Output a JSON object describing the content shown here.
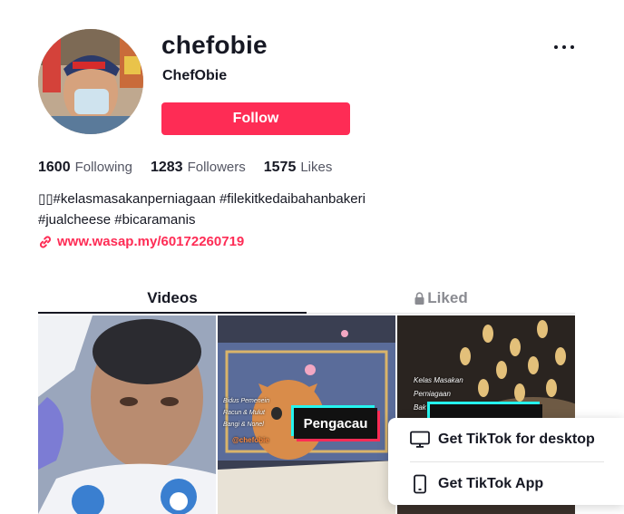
{
  "profile": {
    "username": "chefobie",
    "nickname": "ChefObie",
    "follow_label": "Follow",
    "stats": [
      {
        "value": "1600",
        "label": "Following"
      },
      {
        "value": "1283",
        "label": "Followers"
      },
      {
        "value": "1575",
        "label": "Likes"
      }
    ],
    "bio_line1": "▯▯#kelasmasakanperniagaan #filekitkedaibahanbakeri",
    "bio_line2": "#jualcheese #bicaramanis",
    "link": "www.wasap.my/60172260719"
  },
  "tabs": [
    {
      "label": "Videos",
      "active": true
    },
    {
      "label": "Liked",
      "locked": true
    }
  ],
  "videos": [
    {
      "caption": ""
    },
    {
      "caption_lines": [
        "Bidus Pemenein",
        "Racun & Mulut",
        "Bangi & Nonel"
      ],
      "handle": "@chefobie",
      "tag": "Pengacau"
    },
    {
      "caption_lines": [
        "Kelas Masakan",
        "Perniagaan",
        "Bak"
      ]
    }
  ],
  "popup": {
    "desktop_label": "Get TikTok for desktop",
    "app_label": "Get TikTok App"
  },
  "colors": {
    "accent": "#fe2c55",
    "cyan": "#25f4ee",
    "text": "#161823",
    "muted": "#545663"
  }
}
